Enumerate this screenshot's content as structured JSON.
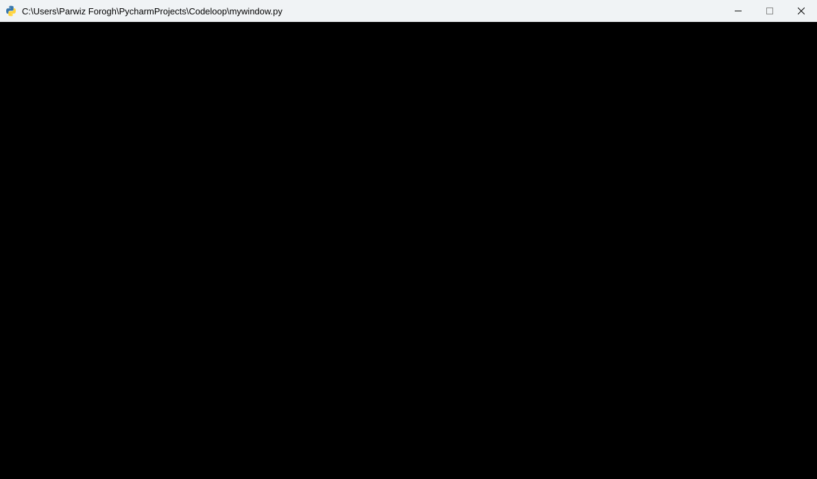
{
  "window": {
    "title": "C:\\Users\\Parwiz Forogh\\PycharmProjects\\Codeloop\\mywindow.py"
  }
}
